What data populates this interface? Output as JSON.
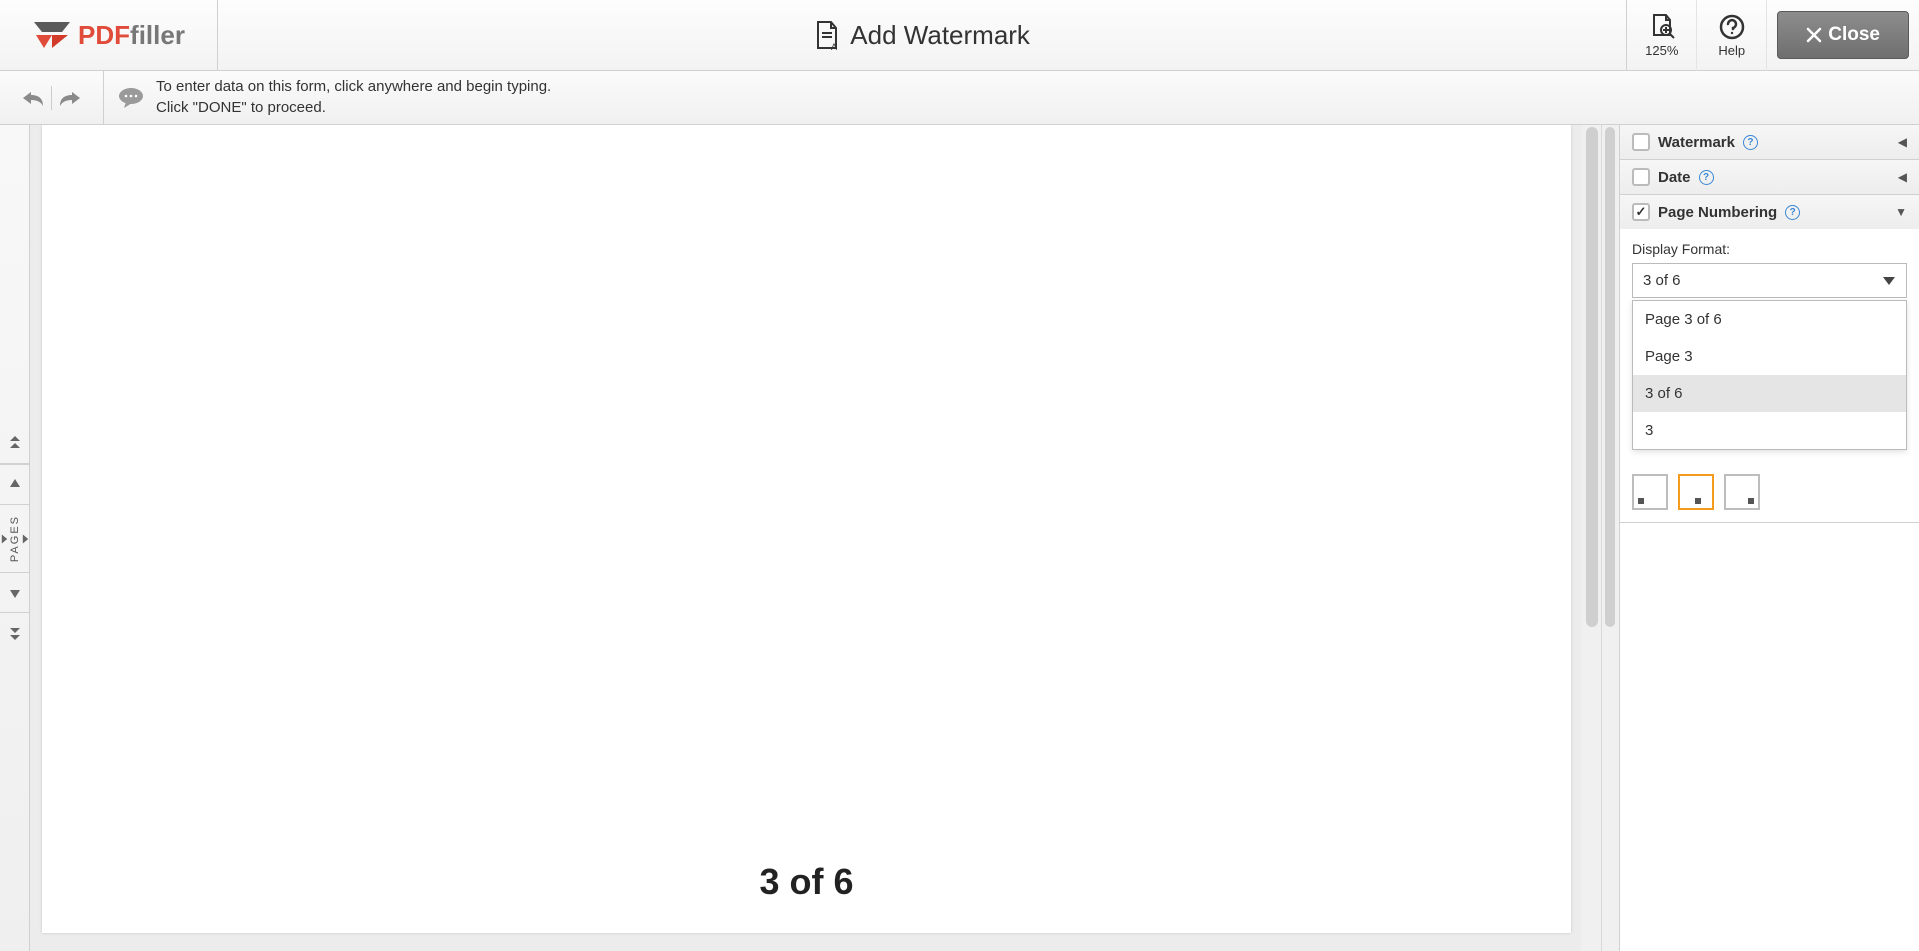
{
  "brand": {
    "name_primary": "PDF",
    "name_secondary": "filler"
  },
  "header": {
    "title": "Add Watermark",
    "zoom_label": "125%",
    "help_label": "Help",
    "close_label": "Close"
  },
  "hint": {
    "line1": "To enter data on this form, click anywhere and begin typing.",
    "line2": "Click \"DONE\" to proceed."
  },
  "pages_rail_label": "PAGES",
  "document": {
    "page_number_display": "3 of 6"
  },
  "panels": {
    "watermark": {
      "title": "Watermark",
      "checked": false,
      "expanded": false
    },
    "date": {
      "title": "Date",
      "checked": false,
      "expanded": false
    },
    "page_numbering": {
      "title": "Page Numbering",
      "checked": true,
      "expanded": true,
      "display_format_label": "Display Format:",
      "selected_value": "3 of 6",
      "options": [
        "Page 3 of 6",
        "Page 3",
        "3 of 6",
        "3"
      ],
      "position_selected": "bottom-center"
    }
  }
}
